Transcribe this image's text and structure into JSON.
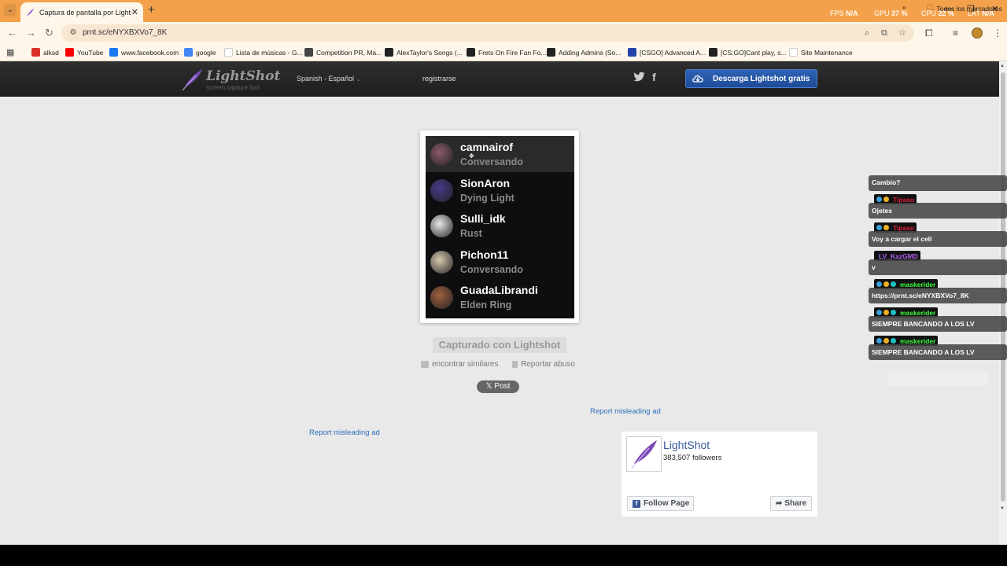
{
  "browser": {
    "tab_title": "Captura de pantalla por Lightsh",
    "tab_close": "✕",
    "new_tab": "+",
    "overlay": {
      "fps_label": "FPS",
      "fps_value": "N/A",
      "gpu_label": "GPU",
      "gpu_value": "37 %",
      "cpu_label": "CPU",
      "cpu_value": "22 %",
      "lat_label": "LAT",
      "lat_value": "N/A"
    },
    "url": "prnt.sc/eNYXBXVo7_8K",
    "bookmarks": [
      {
        "label": "alksd",
        "icon": "gmail-icon",
        "color": "#d93025"
      },
      {
        "label": "YouTube",
        "icon": "youtube-icon",
        "color": "#ff0000"
      },
      {
        "label": "www.facebook.com",
        "icon": "facebook-icon",
        "color": "#1877f2"
      },
      {
        "label": "google",
        "icon": "google-icon",
        "color": "#4285f4"
      },
      {
        "label": "Lista de músicas - G...",
        "icon": "page-icon",
        "color": "#ffffff"
      },
      {
        "label": "Competition PR, Ma...",
        "icon": "web-icon",
        "color": "#444444"
      },
      {
        "label": "AlexTaylor's Songs (...",
        "icon": "web-icon",
        "color": "#222222"
      },
      {
        "label": "Frets On Fire Fan Fo...",
        "icon": "web-icon",
        "color": "#222222"
      },
      {
        "label": "Adding Admins (So...",
        "icon": "web-icon",
        "color": "#222222"
      },
      {
        "label": "[CSGO] Advanced A...",
        "icon": "web-icon",
        "color": "#2244aa"
      },
      {
        "label": "[CS:GO]Cant play, s...",
        "icon": "web-icon",
        "color": "#222222"
      },
      {
        "label": "Site Maintenance",
        "icon": "page-icon",
        "color": "#ffffff"
      }
    ],
    "bookmarks_more": "»",
    "all_bookmarks": "Todos los marcadores"
  },
  "header": {
    "logo_name": "LightShot",
    "logo_tagline": "screen capture tool",
    "language": "Spanish - Español",
    "register": "registrarse",
    "download_button": "Descarga Lightshot gratis"
  },
  "screenshot": {
    "friends": [
      {
        "name": "camnairof",
        "status": "Conversando",
        "avatar_color": "#8a5a6a",
        "active": true
      },
      {
        "name": "SionAron",
        "status": "Dying Light",
        "avatar_color": "#4a3a8a",
        "active": false
      },
      {
        "name": "Sulli_idk",
        "status": "Rust",
        "avatar_color": "#e8e8e8",
        "active": false
      },
      {
        "name": "Pichon11",
        "status": "Conversando",
        "avatar_color": "#d8c8b0",
        "active": false
      },
      {
        "name": "GuadaLibrandi",
        "status": "Elden Ring",
        "avatar_color": "#a06040",
        "active": false
      }
    ]
  },
  "main": {
    "captured_label": "Capturado con Lightshot",
    "similar_label": "encontrar similares",
    "report_label": "Reportar abuso",
    "post_button": "𝕏 Post",
    "report_ad_1": "Report misleading ad",
    "report_ad_2": "Report misleading ad"
  },
  "facebook_widget": {
    "page_name": "LightShot",
    "followers": "383,507 followers",
    "follow_button": "Follow Page",
    "share_button": "Share"
  },
  "chat": [
    {
      "user": "",
      "message": "Cambio?",
      "user_color": ""
    },
    {
      "user": "Tipaso",
      "message": "Ojetes",
      "user_color": "#e0203a"
    },
    {
      "user": "Tipaso",
      "message": "Voy a cargar el cell",
      "user_color": "#e0203a"
    },
    {
      "user": "LV_KazGMD",
      "message": "v",
      "user_color": "#b060f0"
    },
    {
      "user": "maskerider",
      "message": "https://prnt.sc/eNYXBXVo7_8K",
      "user_color": "#40ff40"
    },
    {
      "user": "maskerider",
      "message": "SIEMPRE BANCANDO A LOS LV",
      "user_color": "#40ff40"
    },
    {
      "user": "maskerider",
      "message": "SIEMPRE BANCANDO A LOS LV",
      "user_color": "#40ff40"
    }
  ]
}
